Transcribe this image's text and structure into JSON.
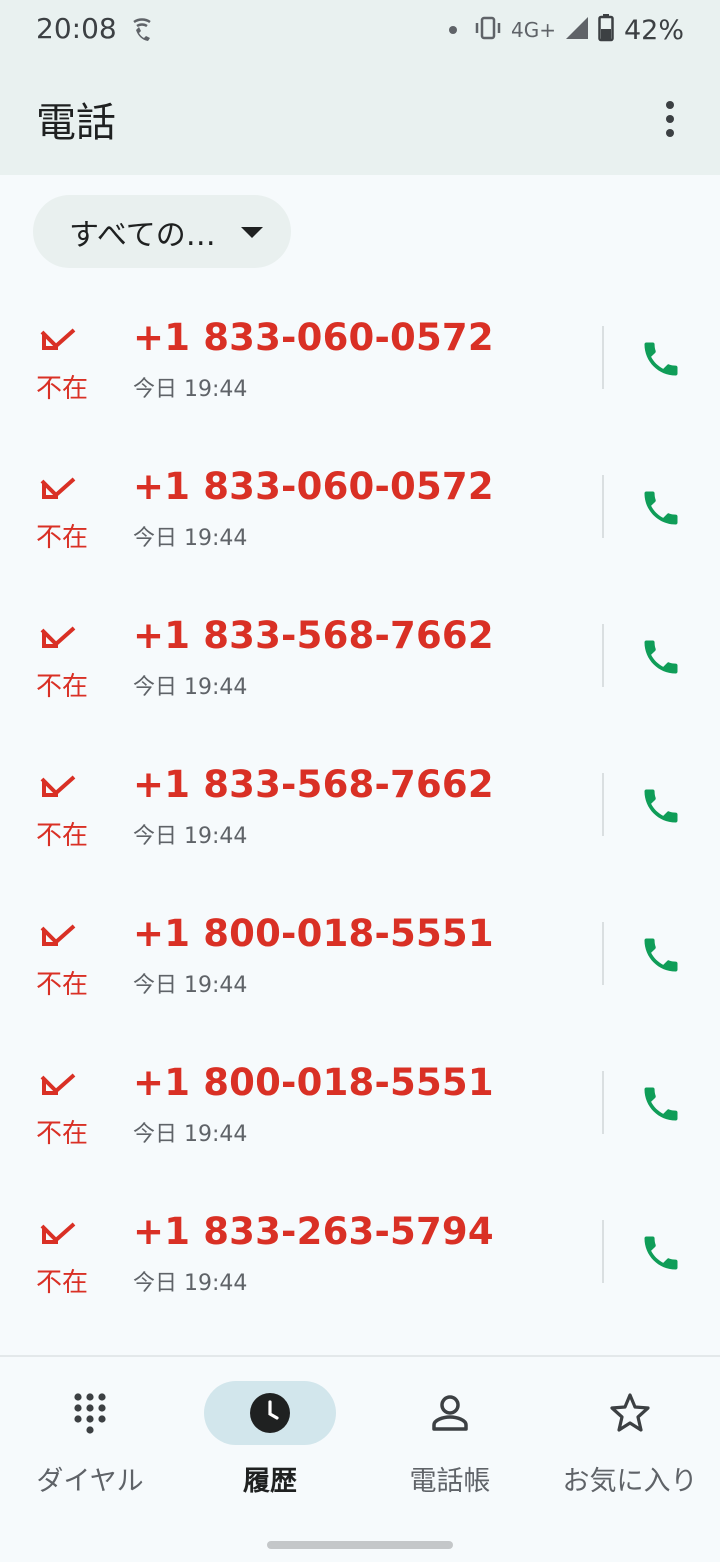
{
  "status_bar": {
    "time": "20:08",
    "network": "4G+",
    "battery_percent": "42%"
  },
  "app_bar": {
    "title": "電話",
    "more_icon": "more-vert-icon"
  },
  "filter": {
    "label": "すべての…"
  },
  "calls": [
    {
      "type": "不在",
      "number": "+1 833-060-0572",
      "time": "今日 19:44"
    },
    {
      "type": "不在",
      "number": "+1 833-060-0572",
      "time": "今日 19:44"
    },
    {
      "type": "不在",
      "number": "+1 833-568-7662",
      "time": "今日 19:44"
    },
    {
      "type": "不在",
      "number": "+1 833-568-7662",
      "time": "今日 19:44"
    },
    {
      "type": "不在",
      "number": "+1 800-018-5551",
      "time": "今日 19:44"
    },
    {
      "type": "不在",
      "number": "+1 800-018-5551",
      "time": "今日 19:44"
    },
    {
      "type": "不在",
      "number": "+1 833-263-5794",
      "time": "今日 19:44"
    }
  ],
  "bottom_nav": {
    "items": [
      {
        "label": "ダイヤル",
        "icon": "dialpad-icon",
        "active": false
      },
      {
        "label": "履歴",
        "icon": "history-clock-icon",
        "active": true
      },
      {
        "label": "電話帳",
        "icon": "contacts-person-icon",
        "active": false
      },
      {
        "label": "お気に入り",
        "icon": "star-icon",
        "active": false
      }
    ]
  },
  "colors": {
    "missed": "#d93025",
    "call_green": "#0f9d58",
    "active_nav_bg": "#d2e6ec",
    "top_bar_bg": "#e9f1f0"
  }
}
